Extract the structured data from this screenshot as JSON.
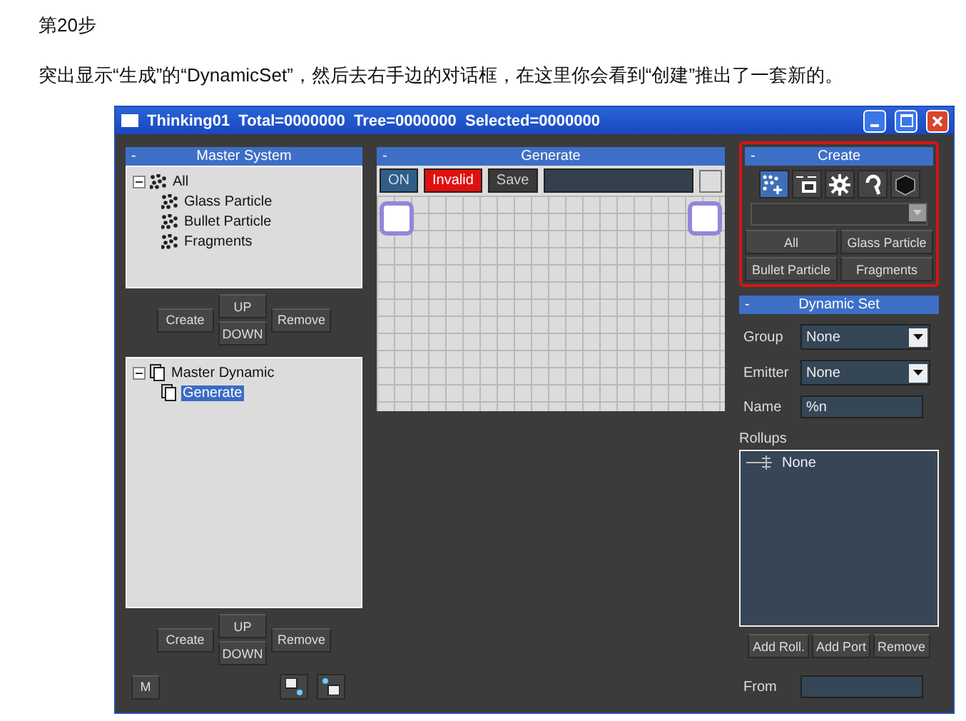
{
  "heading": "第20步",
  "paragraph": "突出显示“生成”的“DynamicSet”，然后去右手边的对话框，在这里你会看到“创建”推出了一套新的。",
  "window": {
    "title": "Thinking01  Total=0000000  Tree=0000000  Selected=0000000"
  },
  "master_system": {
    "collapse": "-",
    "title": "Master System",
    "tree": [
      {
        "label": "All",
        "selected": false,
        "expanded": true,
        "children": [
          {
            "label": "Glass Particle",
            "selected": false
          },
          {
            "label": "Bullet Particle",
            "selected": false
          },
          {
            "label": "Fragments",
            "selected": false
          }
        ]
      }
    ],
    "buttons": {
      "create": "Create",
      "up": "UP",
      "down": "DOWN",
      "remove": "Remove"
    }
  },
  "master_dynamic": {
    "tree": [
      {
        "label": "Master Dynamic",
        "selected": false,
        "expanded": true,
        "children": [
          {
            "label": "Generate",
            "selected": true
          }
        ]
      }
    ],
    "buttons": {
      "create": "Create",
      "up": "UP",
      "down": "DOWN",
      "remove": "Remove"
    },
    "m_button": "M"
  },
  "generate": {
    "collapse": "-",
    "title": "Generate",
    "on": "ON",
    "invalid": "Invalid",
    "save": "Save"
  },
  "create": {
    "collapse": "-",
    "title": "Create",
    "tools": [
      {
        "kind": "particles",
        "selected": true
      },
      {
        "kind": "ok",
        "selected": false
      },
      {
        "kind": "gear",
        "selected": false
      },
      {
        "kind": "hook",
        "selected": false
      },
      {
        "kind": "cube",
        "selected": false
      }
    ],
    "buttons": [
      "All",
      "Glass Particle",
      "Bullet Particle",
      "Fragments"
    ]
  },
  "dynamic_set": {
    "collapse": "-",
    "title": "Dynamic Set",
    "fields": [
      {
        "kind": "select",
        "label": "Group",
        "value": "None"
      },
      {
        "kind": "select",
        "label": "Emitter",
        "value": "None"
      },
      {
        "kind": "text",
        "label": "Name",
        "value": "%n"
      }
    ],
    "rollups_label": "Rollups",
    "rollups": [
      "None"
    ],
    "buttons": [
      "Add Roll.",
      "Add Port",
      "Remove"
    ],
    "from_label": "From"
  }
}
